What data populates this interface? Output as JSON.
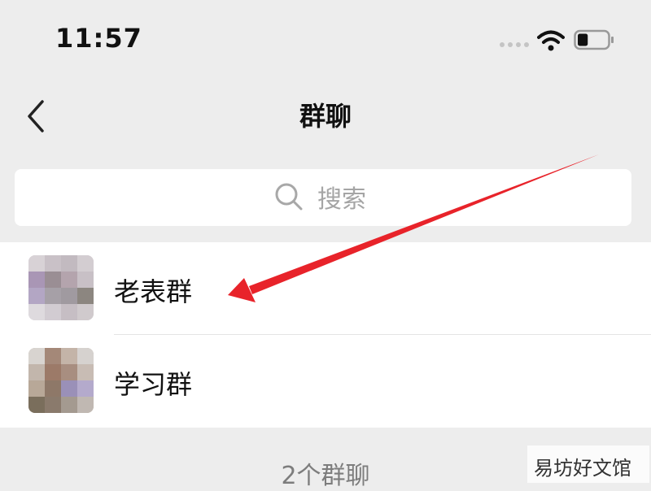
{
  "status_bar": {
    "time": "11:57",
    "battery_level": 0.35
  },
  "nav": {
    "title": "群聊",
    "back_icon": "chevron-left-icon"
  },
  "search": {
    "placeholder": "搜索",
    "icon": "search-icon"
  },
  "groups": [
    {
      "name": "老表群"
    },
    {
      "name": "学习群"
    }
  ],
  "footer": {
    "count_text": "2个群聊"
  },
  "watermark": {
    "text": "易坊好文馆"
  },
  "colors": {
    "background": "#ededed",
    "annotation_arrow": "#e8232a",
    "text": "#111111",
    "muted": "#a5a5a5"
  }
}
